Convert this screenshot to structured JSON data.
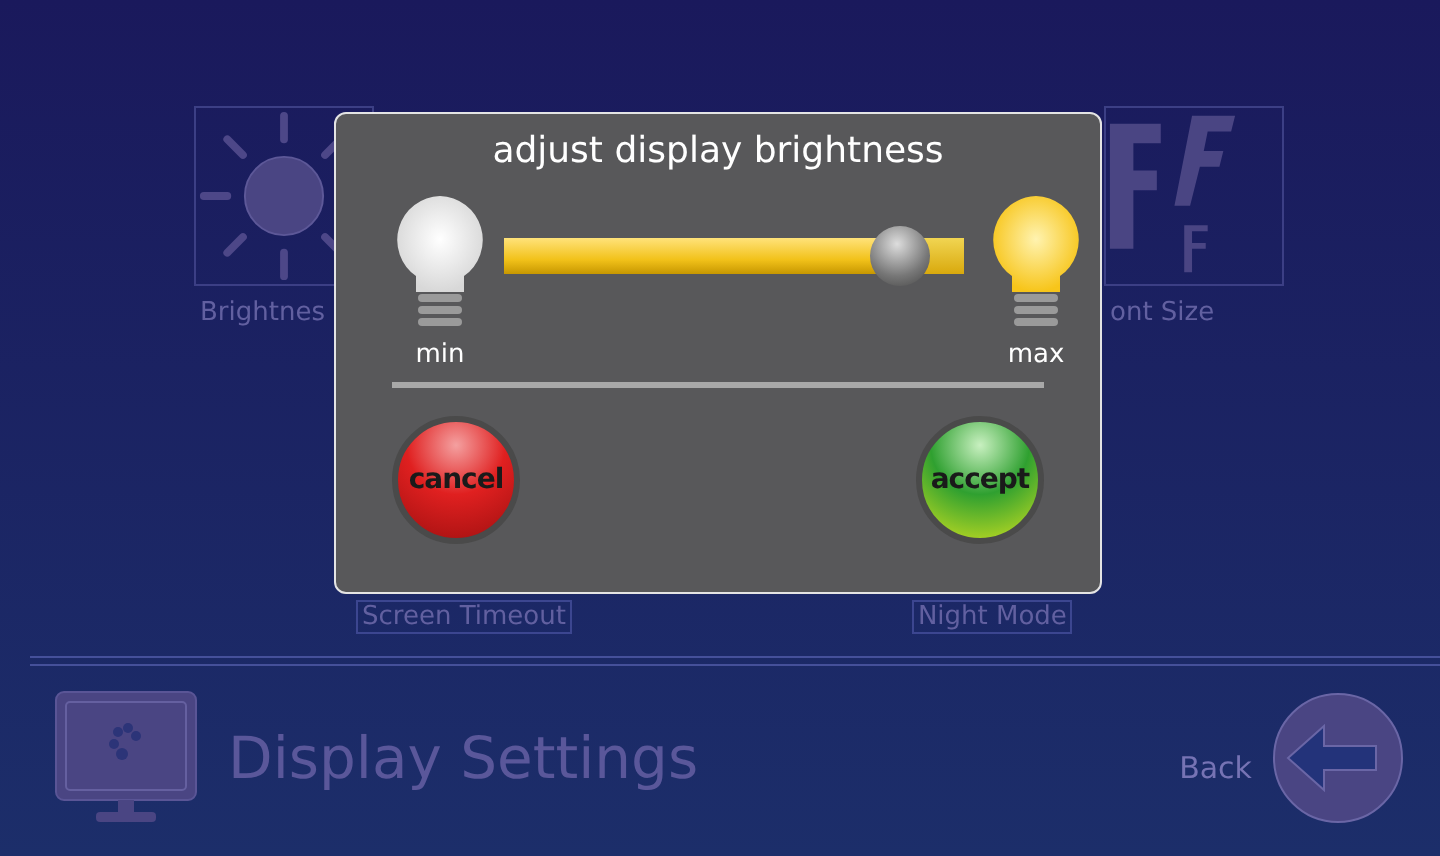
{
  "menu": {
    "tiles": [
      {
        "label": "Brightnes",
        "kind": "brightness"
      },
      {
        "label": "ont Size",
        "kind": "font"
      }
    ],
    "lower_labels": [
      {
        "label": "Screen Timeout"
      },
      {
        "label": "Night Mode"
      }
    ]
  },
  "footer": {
    "title": "Display Settings",
    "back_label": "Back"
  },
  "dialog": {
    "title": "adjust display brightness",
    "slider": {
      "min_label": "min",
      "max_label": "max",
      "level": 0.86
    },
    "buttons": [
      {
        "label": "cancel",
        "kind": "cancel"
      },
      {
        "label": "accept",
        "kind": "accept"
      }
    ]
  }
}
